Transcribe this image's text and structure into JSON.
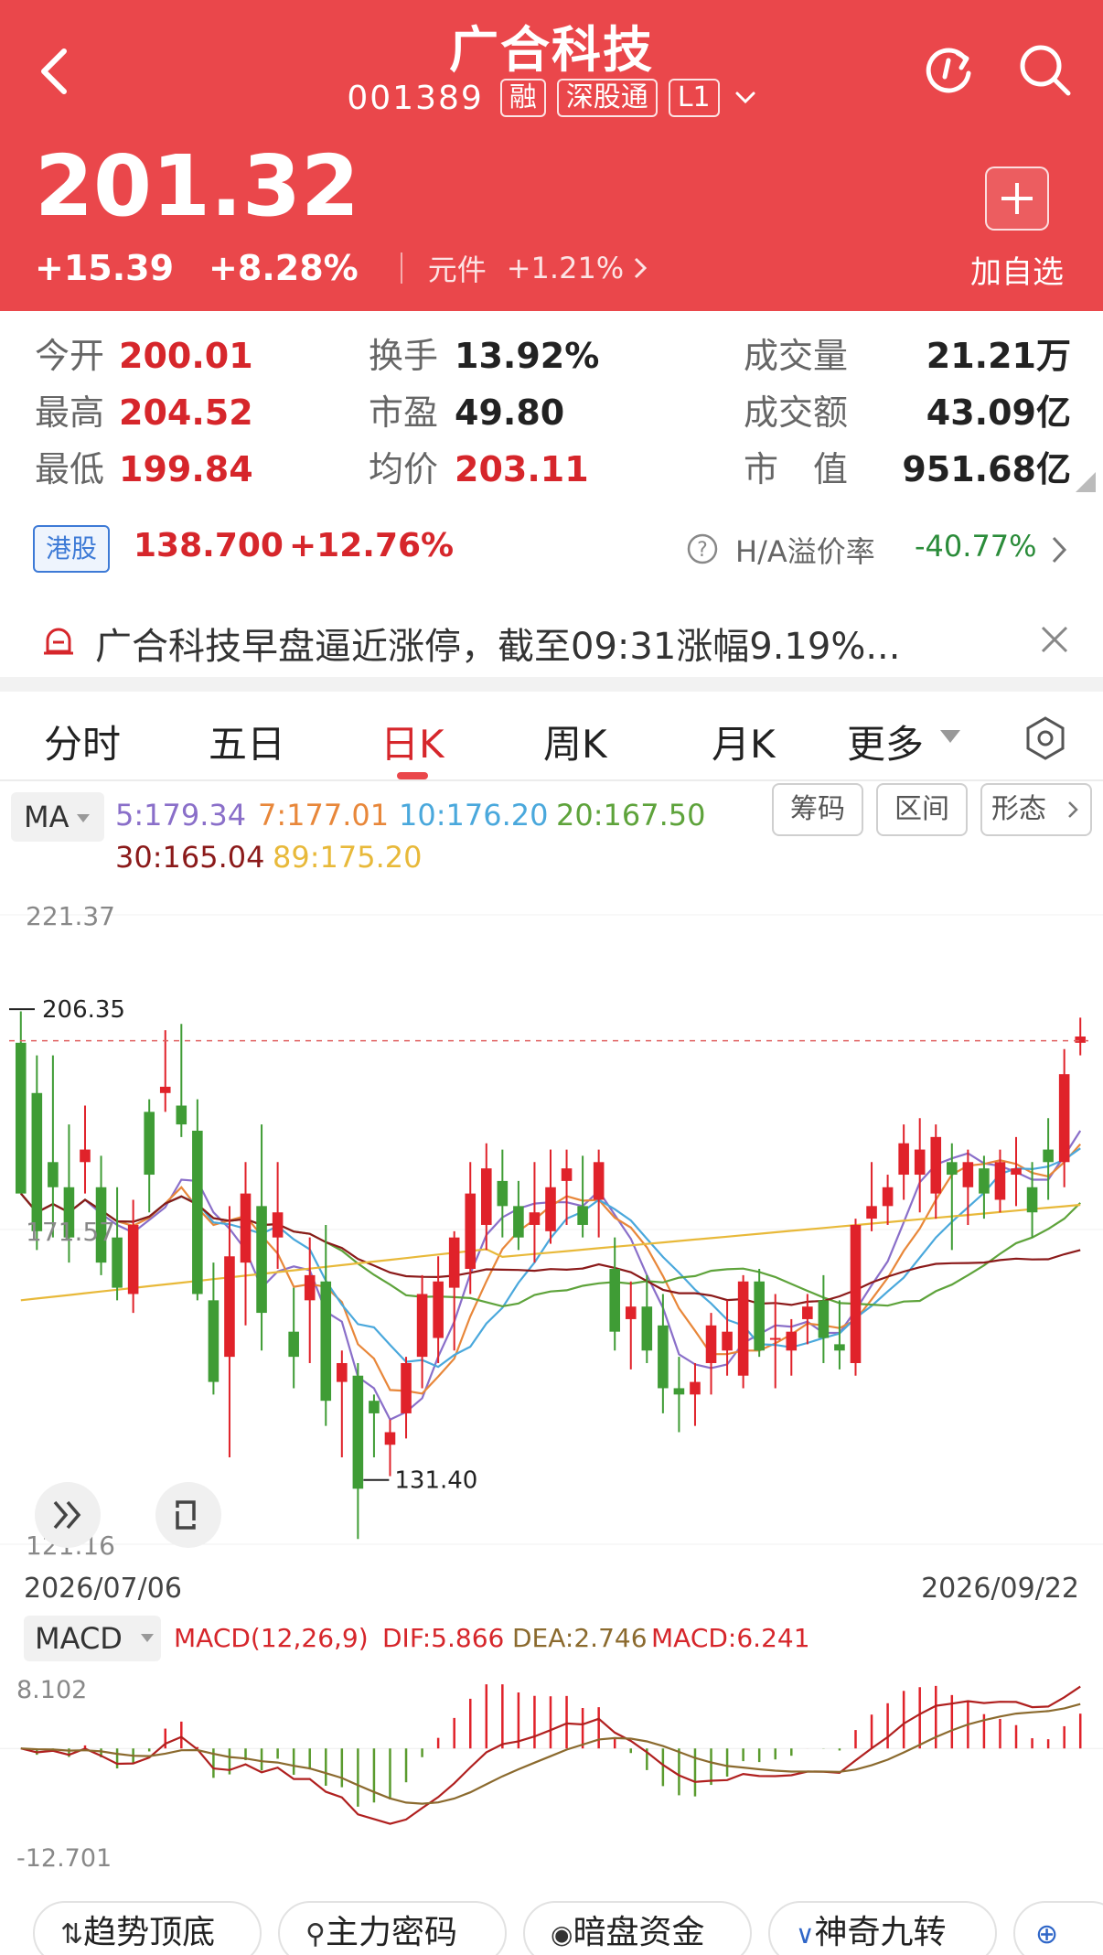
{
  "header": {
    "title": "广合科技",
    "code": "001389",
    "tags": [
      "融",
      "深股通",
      "L1"
    ],
    "price": "201.32",
    "change": "+15.39",
    "change_pct": "+8.28%",
    "sector": "元件",
    "sector_change": "+1.21%",
    "add_label": "加自选"
  },
  "stats": [
    {
      "label": "今开",
      "value": "200.01",
      "color": "red"
    },
    {
      "label": "换手",
      "value": "13.92%",
      "color": "dark"
    },
    {
      "label": "成交量",
      "value": "21.21万",
      "color": "dark"
    },
    {
      "label": "最高",
      "value": "204.52",
      "color": "red"
    },
    {
      "label": "市盈",
      "value": "49.80",
      "color": "dark"
    },
    {
      "label": "成交额",
      "value": "43.09亿",
      "color": "dark"
    },
    {
      "label": "最低",
      "value": "199.84",
      "color": "red"
    },
    {
      "label": "均价",
      "value": "203.11",
      "color": "red"
    },
    {
      "label": "市　值",
      "value": "951.68亿",
      "color": "dark"
    }
  ],
  "hk": {
    "badge": "港股",
    "price": "138.700",
    "change": "+12.76%",
    "premium_label": "H/A溢价率",
    "premium_value": "-40.77%"
  },
  "news": {
    "text": "广合科技早盘逼近涨停，截至09:31涨幅9.19%..."
  },
  "tabs": [
    "分时",
    "五日",
    "日K",
    "周K",
    "月K",
    "更多"
  ],
  "active_tab": "日K",
  "ma": {
    "select": "MA",
    "items": [
      {
        "label": "5:179.34",
        "color": "#8a6fc9"
      },
      {
        "label": "7:177.01",
        "color": "#e8873a"
      },
      {
        "label": "10:176.20",
        "color": "#4aa8dc"
      },
      {
        "label": "20:167.50",
        "color": "#5ea33b"
      },
      {
        "label": "30:165.04",
        "color": "#8b1a1a"
      },
      {
        "label": "89:175.20",
        "color": "#e8b93a"
      }
    ],
    "buttons": [
      "筹码",
      "区间",
      "形态"
    ]
  },
  "chart_data": {
    "type": "candlestick",
    "ylim": [
      121.16,
      221.37
    ],
    "y_ticks": [
      "221.37",
      "171.57",
      "121.16"
    ],
    "high_marker": "206.35",
    "low_marker": "131.40",
    "x_start": "2026/07/06",
    "x_end": "2026/09/22",
    "candles": [
      [
        201,
        206,
        193,
        177
      ],
      [
        193,
        199,
        168,
        171
      ],
      [
        182,
        199,
        170,
        178
      ],
      [
        178,
        188,
        166,
        170
      ],
      [
        182,
        191,
        177,
        184
      ],
      [
        178,
        183,
        164,
        166
      ],
      [
        170,
        178,
        160,
        162
      ],
      [
        161,
        176,
        158,
        172
      ],
      [
        190,
        192,
        174,
        180
      ],
      [
        193,
        203,
        190,
        194
      ],
      [
        191,
        204,
        186,
        188
      ],
      [
        187,
        192,
        160,
        161
      ],
      [
        160,
        166,
        145,
        147
      ],
      [
        151,
        175,
        135,
        167
      ],
      [
        166,
        182,
        156,
        177
      ],
      [
        175,
        188,
        152,
        158
      ],
      [
        170,
        182,
        165,
        174
      ],
      [
        155,
        162,
        146,
        151
      ],
      [
        160,
        170,
        150,
        164
      ],
      [
        163,
        172,
        140,
        144
      ],
      [
        147,
        152,
        135,
        150
      ],
      [
        148,
        150,
        122,
        130
      ],
      [
        144,
        145,
        135,
        142
      ],
      [
        137,
        141,
        132,
        139
      ],
      [
        142,
        151,
        138,
        150
      ],
      [
        151,
        164,
        146,
        161
      ],
      [
        154,
        167,
        150,
        163
      ],
      [
        162,
        171,
        152,
        170
      ],
      [
        165,
        182,
        161,
        177
      ],
      [
        172,
        185,
        168,
        181
      ],
      [
        179,
        184,
        170,
        175
      ],
      [
        175,
        179,
        168,
        170
      ],
      [
        172,
        182,
        166,
        174
      ],
      [
        171,
        184,
        169,
        178
      ],
      [
        179,
        184,
        172,
        181
      ],
      [
        175,
        183,
        170,
        172
      ],
      [
        176,
        184,
        170,
        182
      ],
      [
        165,
        170,
        152,
        155
      ],
      [
        157,
        163,
        149,
        159
      ],
      [
        159,
        164,
        150,
        152
      ],
      [
        156,
        161,
        142,
        146
      ],
      [
        146,
        151,
        139,
        145
      ],
      [
        145,
        150,
        140,
        147
      ],
      [
        150,
        158,
        145,
        156
      ],
      [
        152,
        160,
        148,
        155
      ],
      [
        148,
        164,
        146,
        163
      ],
      [
        163,
        165,
        151,
        152
      ],
      [
        154,
        161,
        146,
        154
      ],
      [
        152,
        157,
        148,
        155
      ],
      [
        157,
        161,
        153,
        159
      ],
      [
        160,
        164,
        150,
        154
      ],
      [
        153,
        160,
        149,
        152
      ],
      [
        150,
        173,
        148,
        172
      ],
      [
        173,
        182,
        171,
        175
      ],
      [
        175,
        180,
        172,
        178
      ],
      [
        180,
        188,
        176,
        185
      ],
      [
        180,
        189,
        174,
        184
      ],
      [
        177,
        188,
        173,
        186
      ],
      [
        182,
        185,
        168,
        180
      ],
      [
        178,
        184,
        172,
        182
      ],
      [
        181,
        183,
        173,
        177
      ],
      [
        176,
        184,
        174,
        182
      ],
      [
        180,
        186,
        175,
        181
      ],
      [
        178,
        182,
        170,
        174
      ],
      [
        184,
        189,
        176,
        182
      ],
      [
        182,
        200,
        178,
        196
      ],
      [
        201,
        205,
        199,
        202
      ]
    ],
    "macd": {
      "title": "MACD(12,26,9)",
      "dif": "DIF:5.866",
      "dea": "DEA:2.746",
      "macd": "MACD:6.241",
      "y_top": "8.102",
      "y_bottom": "-12.701",
      "ylim": [
        -12.701,
        8.102
      ]
    }
  },
  "chart_tools": {
    "select": "MACD"
  },
  "bottom_buttons": [
    "趋势顶底",
    "主力密码",
    "暗盘资金",
    "神奇九转"
  ]
}
